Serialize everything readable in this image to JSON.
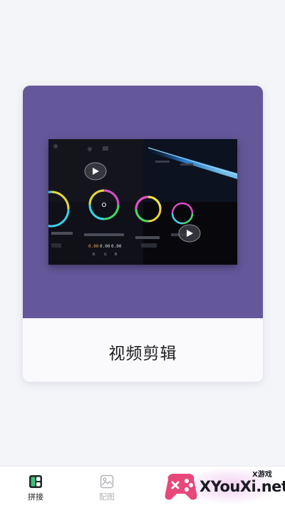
{
  "card": {
    "title": "视频剪辑",
    "accent_color": "#65589a",
    "preview": {
      "wheel_readouts": [
        "0.00",
        "0.00",
        "0.00"
      ],
      "channel_labels": [
        "R",
        "G",
        "B"
      ]
    }
  },
  "tabbar": {
    "tabs": [
      {
        "label": "拼接",
        "icon": "collage-icon",
        "active": true
      },
      {
        "label": "配图",
        "icon": "image-icon",
        "active": false
      }
    ]
  },
  "watermark": {
    "text": "XYouXi.net",
    "badge": "X游戏",
    "icon": "gamepad-icon"
  }
}
